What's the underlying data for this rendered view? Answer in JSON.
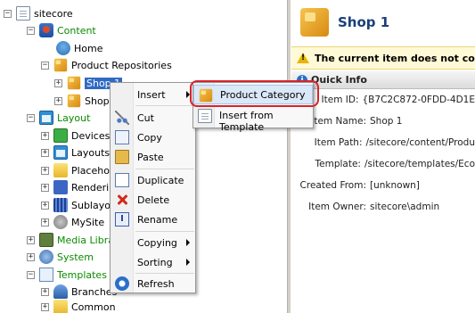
{
  "tree": {
    "root": "sitecore",
    "content": "Content",
    "home": "Home",
    "product_repositories": "Product Repositories",
    "shop1": "Shop 1",
    "shop": "Shop",
    "layout": "Layout",
    "devices": "Devices",
    "layouts": "Layouts",
    "placeholders": "Placehold",
    "renderings": "Rendering",
    "sublayouts": "Sublayou",
    "mysite": "MySite",
    "media_library": "Media Library",
    "system": "System",
    "templates": "Templates",
    "branches": "Branches",
    "common": "Common"
  },
  "context_menu": {
    "insert": "Insert",
    "cut": "Cut",
    "copy": "Copy",
    "paste": "Paste",
    "duplicate": "Duplicate",
    "delete": "Delete",
    "rename": "Rename",
    "copying": "Copying",
    "sorting": "Sorting",
    "refresh": "Refresh"
  },
  "submenu": {
    "product_category": "Product Category",
    "insert_from_template": "Insert from Template"
  },
  "right_pane": {
    "title": "Shop 1",
    "warning": "The current item does not conta",
    "quick_info": "Quick Info",
    "fields": [
      {
        "label": "Item ID:",
        "value": "{B7C2C872-0FDD-4D1E"
      },
      {
        "label": "Item Name:",
        "value": "Shop 1"
      },
      {
        "label": "Item Path:",
        "value": "/sitecore/content/Produ"
      },
      {
        "label": "Template:",
        "value": "/sitecore/templates/Eco"
      },
      {
        "label": "Created From:",
        "value": "[unknown]"
      },
      {
        "label": "Item Owner:",
        "value": "sitecore\\admin"
      }
    ]
  },
  "colors": {
    "accent_blue": "#316ac5",
    "green_text": "#0b8a00",
    "highlight_red": "#d8232a",
    "title_blue": "#1b3f7a"
  }
}
